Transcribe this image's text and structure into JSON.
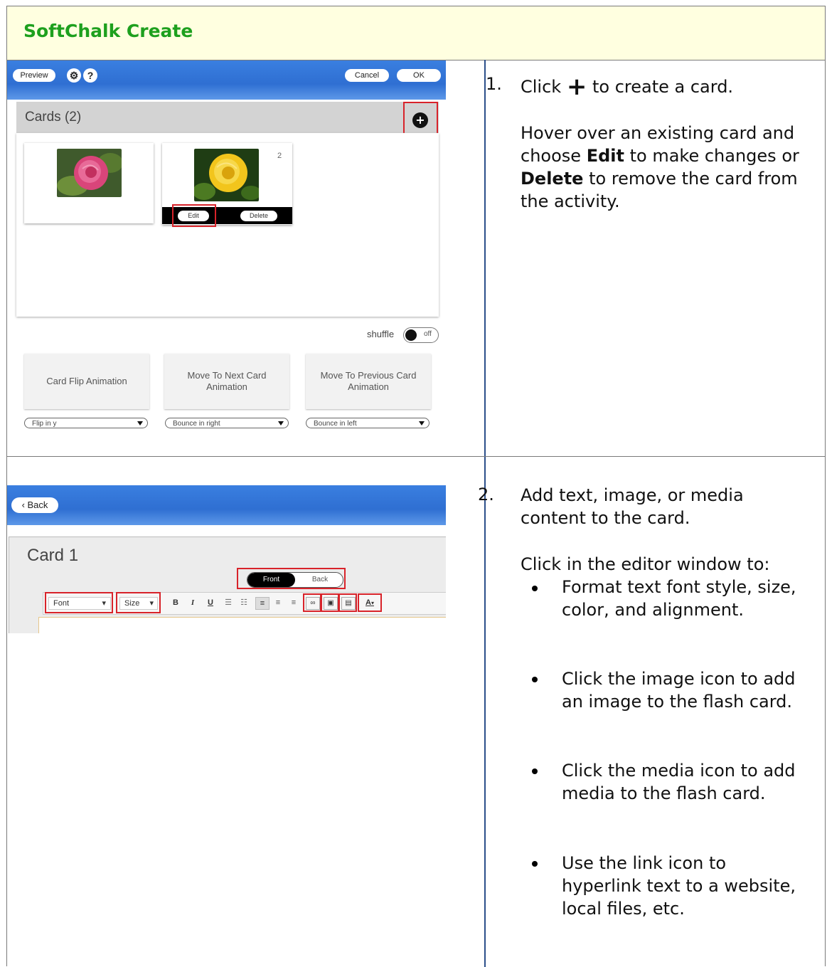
{
  "header": {
    "title": "SoftChalk Create"
  },
  "step1": {
    "number": "1.",
    "line1_pre": "Click",
    "plus_glyph": "+",
    "line1_post": "to create a card.",
    "para_pre": "Hover over an existing card and choose",
    "edit_word": "Edit",
    "para_mid": "to make changes or",
    "delete_word": "Delete",
    "para_post": "to remove the card from the activity."
  },
  "step2": {
    "number": "2.",
    "intro": "Add text, image, or media content to the card.",
    "click_line": "Click in the editor window to:",
    "bullets": [
      "Format text font style, size, color, and alignment.",
      "Click the image icon to add an image to the flash card.",
      "Click the media icon to add media to the flash card.",
      "Use the link icon to hyperlink text to a website, local files, etc."
    ]
  },
  "shot1": {
    "preview_label": "Preview",
    "gear_icon": "gear-icon",
    "help_label": "?",
    "cancel_label": "Cancel",
    "ok_label": "OK",
    "cards_header": "Cards (2)",
    "add_icon": "+",
    "card2_number": "2",
    "edit_label": "Edit",
    "delete_label": "Delete",
    "shuffle_label": "shuffle",
    "toggle_state": "off",
    "animations": [
      {
        "title": "Card Flip Animation",
        "selected": "Flip in y"
      },
      {
        "title": "Move To Next Card Animation",
        "selected": "Bounce in right"
      },
      {
        "title": "Move To Previous Card Animation",
        "selected": "Bounce in left"
      }
    ],
    "colors": {
      "bar": "#2f6fd2",
      "highlight": "#d8232a",
      "rose_pink": "#d9457a",
      "rose_yellow": "#f2c51c"
    }
  },
  "shot2": {
    "back_label": "Back",
    "card_title": "Card 1",
    "front_label": "Front",
    "back_side_label": "Back",
    "font_label": "Font",
    "size_label": "Size",
    "bold": "B",
    "italic": "I",
    "underline": "U",
    "font_color": "A"
  }
}
